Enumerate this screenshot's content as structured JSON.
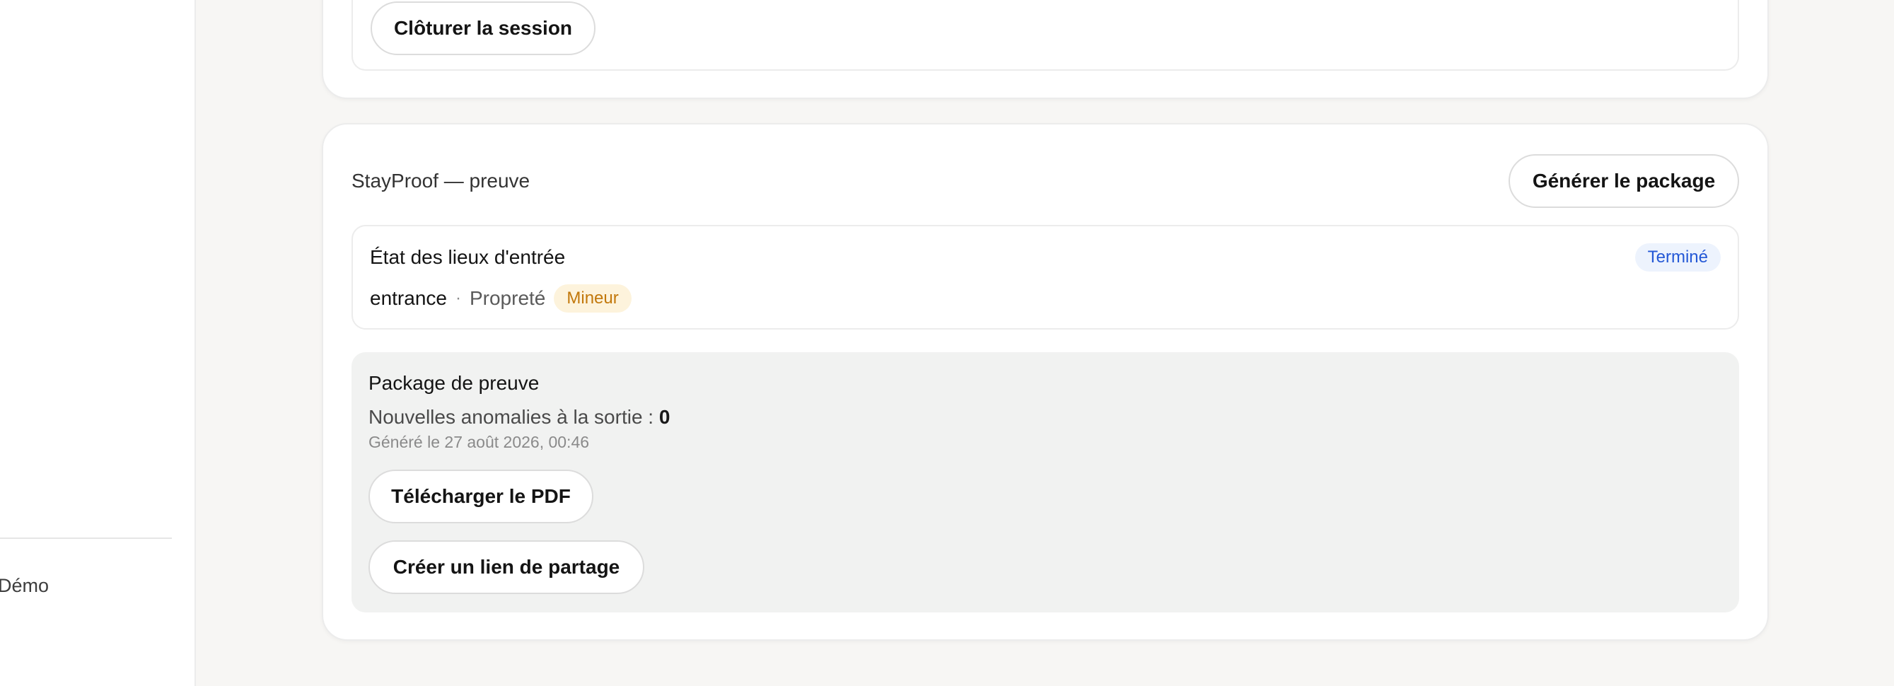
{
  "sidebar": {
    "demo_label": "Démo"
  },
  "session_card": {
    "close_session_label": "Clôturer la session"
  },
  "proof_card": {
    "title": "StayProof — preuve",
    "generate_label": "Générer le package",
    "inspection": {
      "title": "État des lieux d'entrée",
      "status": "Terminé",
      "room": "entrance",
      "separator": "·",
      "category": "Propreté",
      "severity": "Mineur"
    },
    "package": {
      "title": "Package de preuve",
      "anomalies_label": "Nouvelles anomalies à la sortie :",
      "anomalies_count": "0",
      "generated_at": "Généré le 27 août 2026, 00:46",
      "download_label": "Télécharger le PDF",
      "share_label": "Créer un lien de partage"
    }
  },
  "colors": {
    "status_blue": "#2458d6",
    "status_blue_bg": "#edf3fd",
    "severity_amber": "#c2780b",
    "severity_amber_bg": "#fdf3dc",
    "package_bg": "#f1f2f1"
  }
}
